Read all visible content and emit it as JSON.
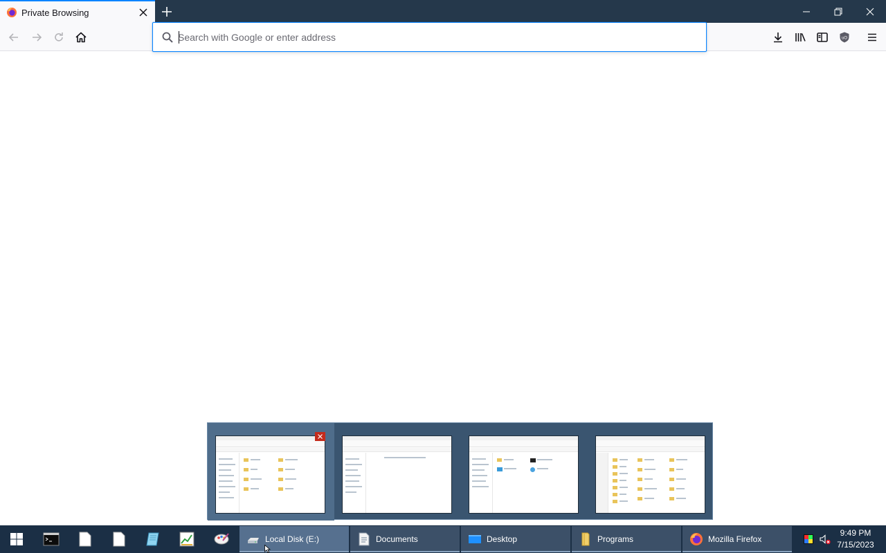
{
  "browser": {
    "tab_title": "Private Browsing",
    "url_placeholder": "Search with Google or enter address",
    "url_value": "",
    "accent": "#0a84ff"
  },
  "preview": {
    "windows": [
      {
        "name": "Local Disk (E:)",
        "hover": true
      },
      {
        "name": "Documents"
      },
      {
        "name": "Desktop"
      },
      {
        "name": "Programs"
      }
    ]
  },
  "taskbar": {
    "tasks": [
      {
        "label": "Local Disk (E:)",
        "icon": "drive-icon",
        "active": true
      },
      {
        "label": "Documents",
        "icon": "document-folder-icon"
      },
      {
        "label": "Desktop",
        "icon": "desktop-folder-icon"
      },
      {
        "label": "Programs",
        "icon": "folder-icon"
      },
      {
        "label": "Mozilla Firefox",
        "icon": "firefox-icon"
      }
    ],
    "time": "9:49 PM",
    "date": "7/15/2023"
  }
}
